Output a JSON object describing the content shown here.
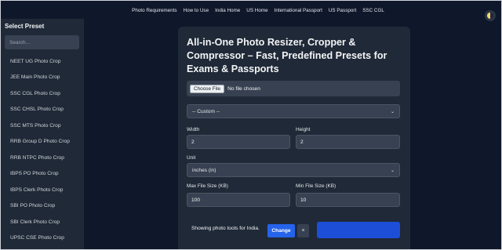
{
  "nav": {
    "links": [
      "Photo Requirements",
      "How to Use",
      "India Home",
      "US Home",
      "International Passport",
      "US Passport",
      "SSC CGL"
    ]
  },
  "sidebar": {
    "title": "Select Preset",
    "search_placeholder": "Search...",
    "items": [
      "NEET UG Photo Crop",
      "JEE Main Photo Crop",
      "SSC CGL Photo Crop",
      "SSC CHSL Photo Crop",
      "SSC MTS Photo Crop",
      "RRB Group D Photo Crop",
      "RRB NTPC Photo Crop",
      "IBPS PO Photo Crop",
      "IBPS Clerk Photo Crop",
      "SBI PO Photo Crop",
      "SBI Clerk Photo Crop",
      "UPSC CSE Photo Crop"
    ]
  },
  "main": {
    "title": "All-in-One Photo Resizer, Cropper & Compressor – Fast, Predefined Presets for Exams & Passports",
    "file_button": "Choose File",
    "file_status": "No file chosen",
    "preset_select": "-- Custom --",
    "width_label": "Width",
    "width_value": "2",
    "height_label": "Height",
    "height_value": "2",
    "unit_label": "Unit",
    "unit_value": "inches (in)",
    "max_size_label": "Max File Size (KB)",
    "max_size_value": "100",
    "min_size_label": "Min File Size (KB)",
    "min_size_value": "10"
  },
  "toast": {
    "text": "Showing photo tools for India.",
    "change_label": "Change",
    "close_label": "×"
  }
}
